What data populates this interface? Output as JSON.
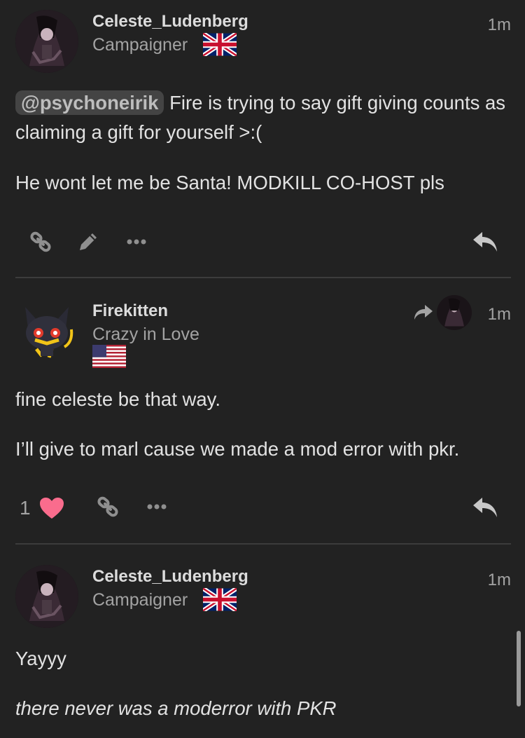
{
  "posts": [
    {
      "username": "Celeste_Ludenberg",
      "user_title": "Campaigner",
      "flag": "uk-flag-icon",
      "time": "1m",
      "mention": "@psychoneirik",
      "body_line1": " Fire is trying to say gift giving counts as claiming a gift for yourself >:(",
      "body_line2": "He wont let me be Santa! MODKILL CO-HOST pls",
      "actions": [
        "link-icon",
        "edit-icon",
        "more-icon",
        "reply-icon"
      ]
    },
    {
      "username": "Firekitten",
      "user_title": "Crazy in Love",
      "flag": "us-flag-icon",
      "time": "1m",
      "body_line1": "fine celeste be that way.",
      "body_line2": "I’ll give to marl cause we made a mod error with pkr.",
      "like_count": "1",
      "actions": [
        "heart-icon",
        "link-icon",
        "more-icon",
        "reply-icon"
      ]
    },
    {
      "username": "Celeste_Ludenberg",
      "user_title": "Campaigner",
      "flag": "uk-flag-icon",
      "time": "1m",
      "body_line1": "Yayyy",
      "body_line2": "there never was a moderror with PKR"
    }
  ],
  "colors": {
    "background": "#222222",
    "heart": "#fa6c8d",
    "muted": "#a3a3a3"
  }
}
